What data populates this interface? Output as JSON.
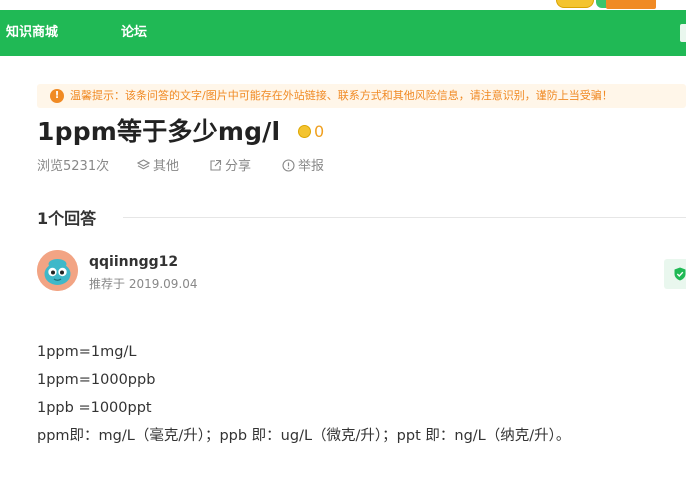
{
  "nav": {
    "items": [
      "知识商城",
      "论坛"
    ]
  },
  "notice": {
    "icon": "exclamation-icon",
    "text": "温馨提示：该条问答的文字/图片中可能存在外站链接、联系方式和其他风险信息，请注意识别，谨防上当受骗！",
    "color": "#f08a24"
  },
  "question": {
    "title": "1ppm等于多少mg/l",
    "reward": "0",
    "views": "浏览5231次",
    "category": "其他",
    "share": "分享",
    "report": "举报"
  },
  "answers": {
    "heading": "1个回答",
    "items": [
      {
        "username": "qqiinngg12",
        "recommend": "推荐于 2019.09.04",
        "lines": [
          "1ppm=1mg/L",
          "1ppm=1000ppb",
          "1ppb =1000ppt",
          "ppm即：mg/L（毫克/升）；ppb 即：ug/L（微克/升）；ppt  即：ng/L（纳克/升）。"
        ]
      }
    ]
  },
  "colors": {
    "brand_green": "#20b955",
    "coin_gold": "#f4c430",
    "notice_orange": "#f08a24"
  }
}
